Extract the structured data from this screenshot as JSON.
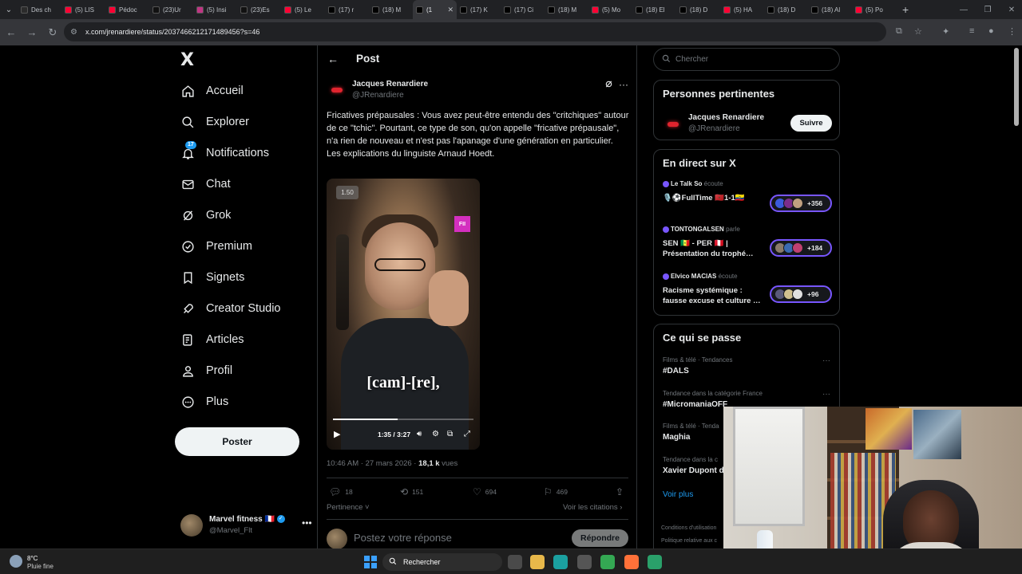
{
  "browser": {
    "tabs": [
      {
        "label": "Des ch",
        "color": "#2b2b2b"
      },
      {
        "label": "(5) LIS",
        "color": "#ff0033"
      },
      {
        "label": "Pédoc",
        "color": "#ff0033"
      },
      {
        "label": "(23)Ur",
        "color": "#111111"
      },
      {
        "label": "(5) Insi",
        "color": "#c13584"
      },
      {
        "label": "(23)Es",
        "color": "#111111"
      },
      {
        "label": "(5) Le",
        "color": "#ff0033"
      },
      {
        "label": "(17) r",
        "color": "#000000"
      },
      {
        "label": "(18) M",
        "color": "#000000"
      },
      {
        "label": "(1",
        "color": "#000000"
      },
      {
        "label": "(17) K",
        "color": "#000000"
      },
      {
        "label": "(17) Ci",
        "color": "#000000"
      },
      {
        "label": "(18) M",
        "color": "#000000"
      },
      {
        "label": "(5) Mo",
        "color": "#ff0033"
      },
      {
        "label": "(18) El",
        "color": "#000000"
      },
      {
        "label": "(18) D",
        "color": "#000000"
      },
      {
        "label": "(5) HA",
        "color": "#ff0033"
      },
      {
        "label": "(18) D",
        "color": "#000000"
      },
      {
        "label": "(18) Al",
        "color": "#000000"
      },
      {
        "label": "(5) Po",
        "color": "#ff0033"
      }
    ],
    "active_tab_index": 9,
    "new_tab_symbol": "+",
    "url": "x.com/jrenardiere/status/2037466212171489456?s=46"
  },
  "nav": {
    "logo": "X",
    "notifications_badge": "17",
    "items": [
      {
        "label": "Accueil",
        "icon": "home-icon"
      },
      {
        "label": "Explorer",
        "icon": "search-icon"
      },
      {
        "label": "Notifications",
        "icon": "bell-icon"
      },
      {
        "label": "Chat",
        "icon": "mail-icon"
      },
      {
        "label": "Grok",
        "icon": "grok-icon"
      },
      {
        "label": "Premium",
        "icon": "premium-icon"
      },
      {
        "label": "Signets",
        "icon": "bookmark-icon"
      },
      {
        "label": "Creator Studio",
        "icon": "rocket-icon"
      },
      {
        "label": "Articles",
        "icon": "article-icon"
      },
      {
        "label": "Profil",
        "icon": "person-icon"
      },
      {
        "label": "Plus",
        "icon": "more-circle-icon"
      }
    ],
    "post_button": "Poster",
    "account": {
      "name": "Marvel fitness 🇫🇷",
      "handle": "@Marvel_Flt"
    }
  },
  "post": {
    "header_title": "Post",
    "author_name": "Jacques Renardiere",
    "author_handle": "@JRenardiere",
    "text": "Fricatives prépausales : Vous avez peut-être entendu des \"critchiques\" autour de ce \"tchic\". Pourtant, ce type de son, qu'on appelle \"fricative prépausale\", n'a rien de nouveau et n'est pas l'apanage d'une génération en particulier.\nLes explications du linguiste Arnaud Hoedt.",
    "video": {
      "speed_badge": "1.50",
      "channel_badge": "FII",
      "caption": "[cam]-[re],",
      "time": "1:35 / 3:27",
      "progress": 0.46
    },
    "meta_time": "10:46 AM · 27 mars 2026 · ",
    "meta_views": "18,1 k",
    "meta_views_suffix": " vues",
    "actions": {
      "replies": "18",
      "reposts": "151",
      "likes": "694",
      "bookmarks": "469"
    },
    "pertinence": "Pertinence ˅",
    "voir_citations": "Voir les citations ›",
    "reply_placeholder": "Postez votre réponse",
    "reply_button": "Répondre"
  },
  "sidebar": {
    "search_placeholder": "Chercher",
    "relevant": {
      "title": "Personnes pertinentes",
      "name": "Jacques Renardiere",
      "handle": "@JRenardiere",
      "follow": "Suivre"
    },
    "live": {
      "title": "En direct sur X",
      "spaces": [
        {
          "host": "Le Talk So",
          "activity": "écoute",
          "title": "🎙️⚽FullTime 🇲🇦1-1🇪🇨",
          "count": "+356",
          "colors": [
            "#3b5bdb",
            "#7b2d8b",
            "#c0a080"
          ]
        },
        {
          "host": "TONTONGALSEN",
          "activity": "parle",
          "title": "SEN 🇸🇳 - PER 🇵🇪 | Présentation du trophé…",
          "count": "+184",
          "colors": [
            "#8a7a6a",
            "#3a6ab0",
            "#c04070"
          ]
        },
        {
          "host": "Elvico MACIAS",
          "activity": "écoute",
          "title": "Racisme systémique : fausse excuse et culture …",
          "count": "+96",
          "colors": [
            "#5a5a7a",
            "#d0c090",
            "#e0e0e0"
          ]
        }
      ]
    },
    "happening": {
      "title": "Ce qui se passe",
      "trends": [
        {
          "category": "Films & télé · Tendances",
          "name": "#DALS"
        },
        {
          "category": "Tendance dans la catégorie France",
          "name": "#MicromaniaOFF"
        },
        {
          "category": "Films & télé · Tenda",
          "name": "Maghia"
        },
        {
          "category": "Tendance dans la c",
          "name": "Xavier Dupont d"
        }
      ],
      "voir_plus": "Voir plus"
    },
    "footer": [
      "Conditions d'utilisation",
      "Politique relative aux c"
    ]
  },
  "taskbar": {
    "temperature": "8°C",
    "condition": "Pluie fine",
    "search_label": "Rechercher",
    "apps": [
      {
        "name": "task-view",
        "color": "#4a4a4a"
      },
      {
        "name": "file-explorer",
        "color": "#e8b84a"
      },
      {
        "name": "edge",
        "color": "#1ba0a0"
      },
      {
        "name": "store",
        "color": "#555555"
      },
      {
        "name": "chrome",
        "color": "#34a853"
      },
      {
        "name": "firefox",
        "color": "#ff7139"
      },
      {
        "name": "app",
        "color": "#2aa06a"
      }
    ]
  },
  "colors": {
    "accent": "#1d9bf0",
    "live_purple": "#7856ff",
    "background": "#000000"
  }
}
